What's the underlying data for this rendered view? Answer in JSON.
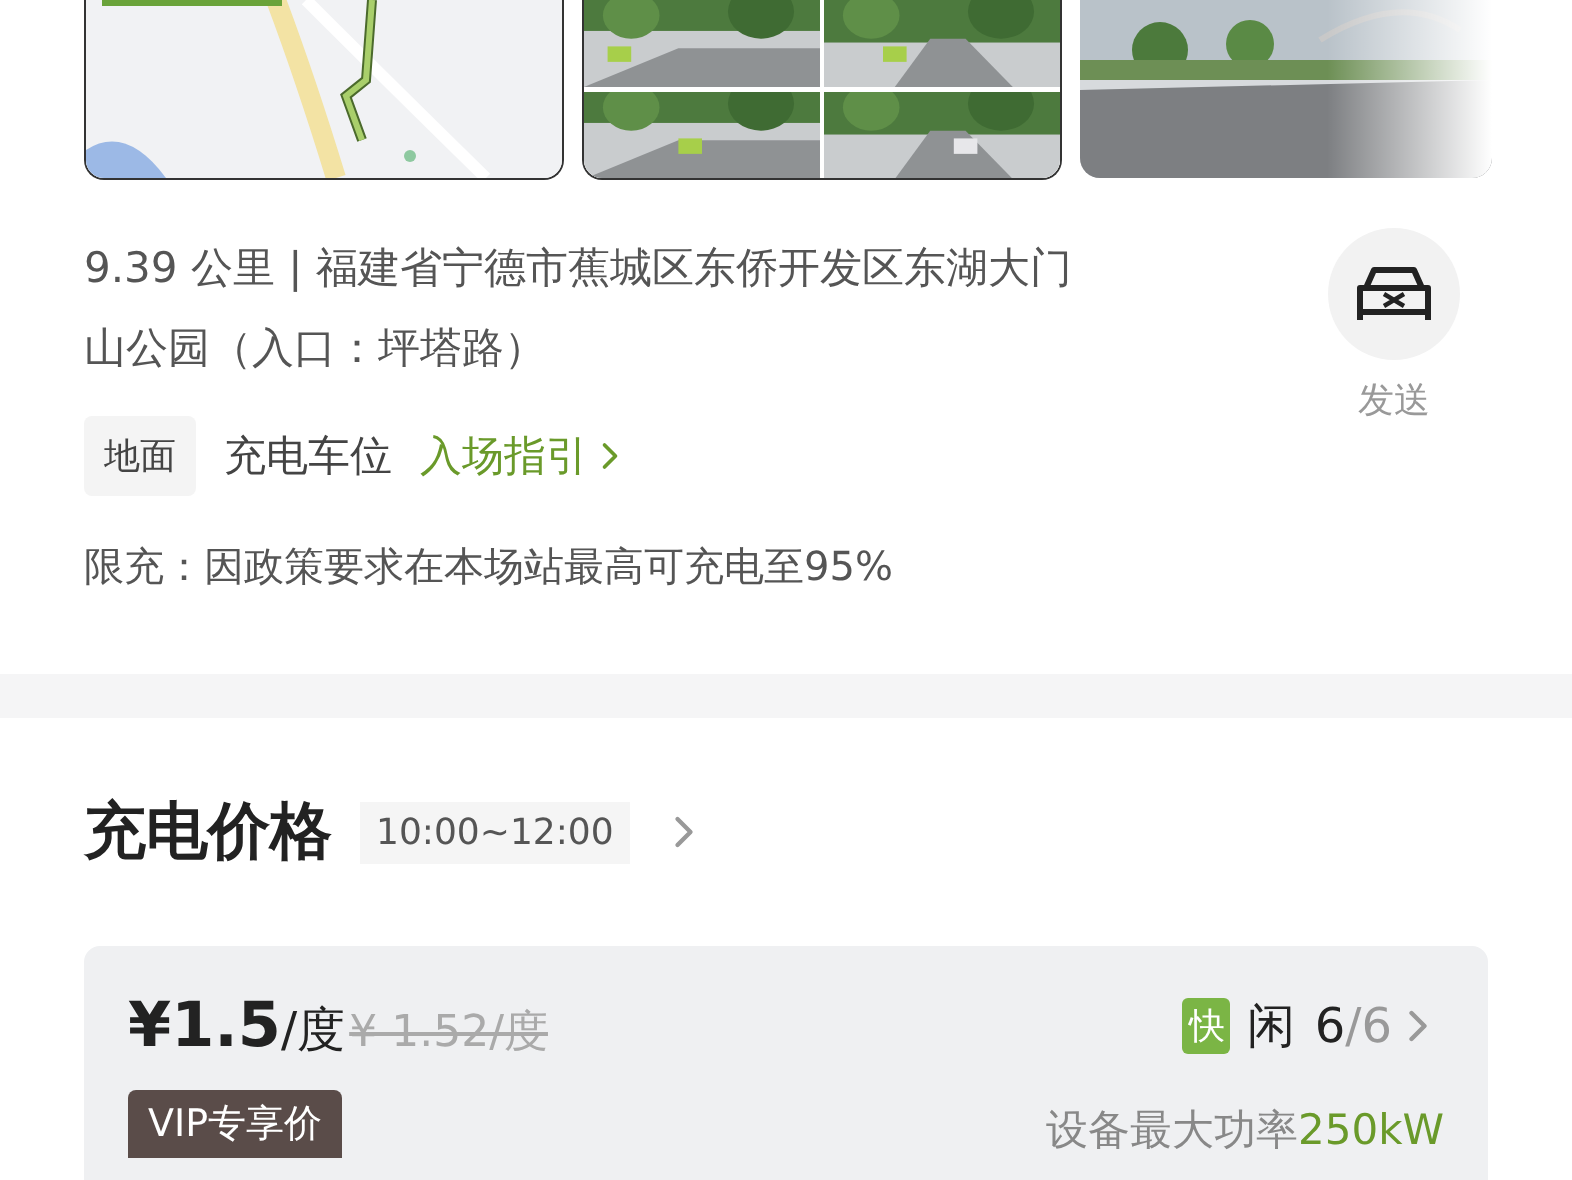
{
  "address": {
    "text": "9.39 公里 | 福建省宁德市蕉城区东侨开发区东湖大门山公园（入口：坪塔路）"
  },
  "send_button": {
    "label": "发送"
  },
  "parking": {
    "floor": "地面",
    "type": "充电车位",
    "guide_link": "入场指引"
  },
  "limit_note": "限充：因政策要求在本场站最高可充电至95%",
  "price_section": {
    "title": "充电价格",
    "time_range": "10:00~12:00"
  },
  "price_card": {
    "price": "¥1.5",
    "unit": "/度",
    "original_price": "¥ 1.52/度",
    "speed_badge": "快",
    "status": "闲",
    "available": "6",
    "total": "/6",
    "vip_tag": "VIP专享价",
    "power_label": "设备最大功率",
    "power_value": "250kW"
  }
}
